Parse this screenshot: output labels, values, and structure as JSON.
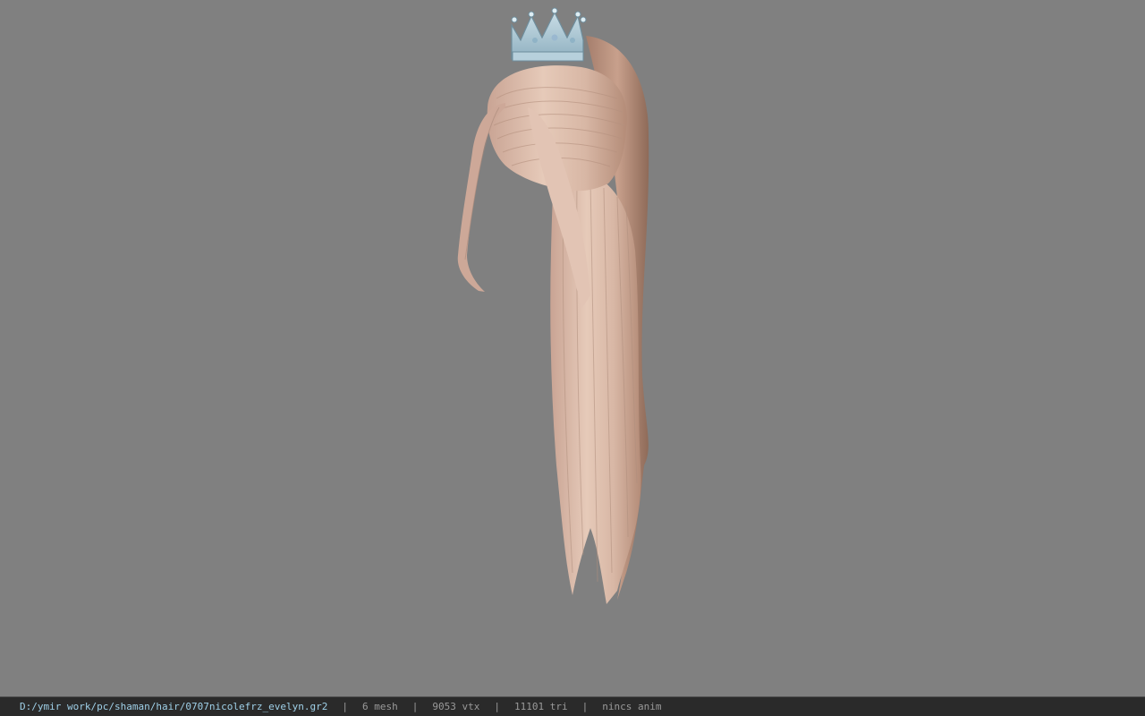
{
  "viewport": {
    "background_color": "#808080",
    "model": {
      "description_icon": "hair-model-with-crown-icon",
      "hair_color": "#d9b8a8",
      "crown_color": "#a9c6d4"
    }
  },
  "status_bar": {
    "file_path": "D:/ymir work/pc/shaman/hair/0707nicolefrz_evelyn.gr2",
    "separator": "|",
    "mesh": "6 mesh",
    "vtx": "9053 vtx",
    "tri": "11101 tri",
    "anim": "nincs anim",
    "path_color": "#9fd0e8",
    "text_color": "#9a9a9a"
  }
}
